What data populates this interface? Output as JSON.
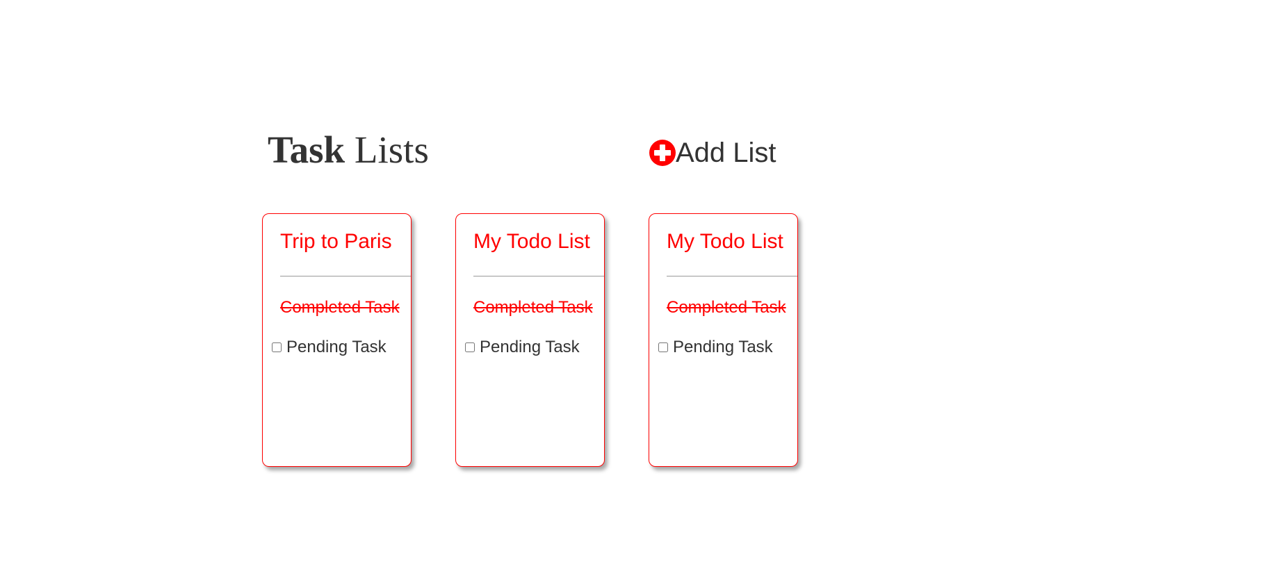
{
  "header": {
    "title_bold": "Task",
    "title_rest": " Lists",
    "add_list": {
      "icon": "plus-circle-icon",
      "label": "Add List"
    }
  },
  "colors": {
    "accent": "#ff0000",
    "text": "#333333",
    "divider": "#999999"
  },
  "lists": [
    {
      "title": "Trip to Paris",
      "completed_task": "Completed Task",
      "pending_task": "Pending Task",
      "pending_checked": false
    },
    {
      "title": "My Todo List",
      "completed_task": "Completed Task",
      "pending_task": "Pending Task",
      "pending_checked": false
    },
    {
      "title": "My Todo List",
      "completed_task": "Completed Task",
      "pending_task": "Pending Task",
      "pending_checked": false
    }
  ]
}
